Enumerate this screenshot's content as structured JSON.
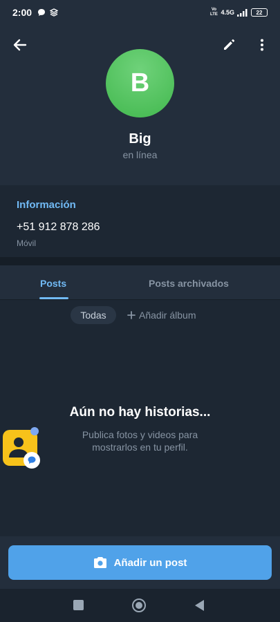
{
  "status_bar": {
    "time": "2:00",
    "network": "4.5G",
    "volte": "Vo LTE",
    "battery": "22"
  },
  "profile": {
    "avatar_letter": "B",
    "name": "Big",
    "status": "en línea"
  },
  "info": {
    "header": "Información",
    "phone": "+51 912 878 286",
    "phone_label": "Móvil"
  },
  "tabs": [
    {
      "label": "Posts",
      "active": true
    },
    {
      "label": "Posts archivados",
      "active": false
    }
  ],
  "filters": {
    "all_label": "Todas",
    "add_album_label": "Añadir álbum"
  },
  "empty_state": {
    "title": "Aún no hay historias...",
    "subtitle_line1": "Publica fotos y videos para",
    "subtitle_line2": "mostrarlos en tu perfil."
  },
  "add_post": {
    "label": "Añadir un post"
  },
  "colors": {
    "background": "#1d2733",
    "header_bg": "#232e3c",
    "accent_blue": "#71baf5",
    "button_blue": "#50a2e9",
    "avatar_green": "#42b84e",
    "muted_text": "#8794a3"
  },
  "icons": {
    "back": "arrow-left-icon",
    "edit": "pencil-icon",
    "more": "more-vertical-icon",
    "camera": "camera-icon",
    "plus": "plus-icon"
  }
}
